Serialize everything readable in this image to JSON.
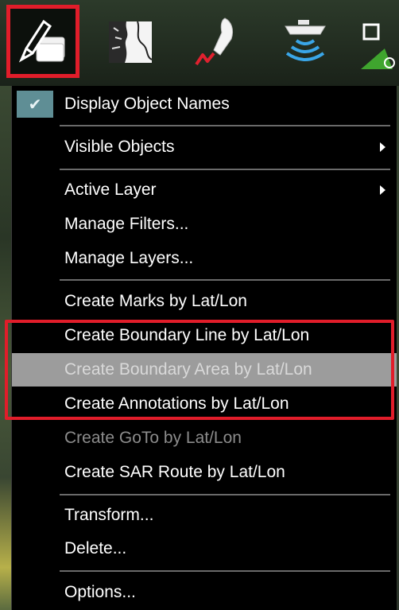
{
  "toolbar": {
    "tools": [
      {
        "icon": "edit-objects-icon",
        "active": true
      },
      {
        "icon": "chart-map-icon",
        "active": false
      },
      {
        "icon": "vessel-track-icon",
        "active": false
      },
      {
        "icon": "sonar-ship-icon",
        "active": false
      },
      {
        "icon": "select-pointer-icon",
        "active": false
      }
    ]
  },
  "menu": {
    "items": [
      {
        "label": "Display Object Names",
        "checked": true
      },
      {
        "label": "Visible Objects",
        "submenu": true
      },
      {
        "label": "Active Layer",
        "submenu": true
      },
      {
        "label": "Manage Filters..."
      },
      {
        "label": "Manage Layers..."
      },
      {
        "label": "Create Marks by Lat/Lon"
      },
      {
        "label": "Create Boundary Line by Lat/Lon"
      },
      {
        "label": "Create Boundary Area by Lat/Lon",
        "highlighted": true
      },
      {
        "label": "Create Annotations by Lat/Lon"
      },
      {
        "label": "Create GoTo by Lat/Lon",
        "disabled": true
      },
      {
        "label": "Create SAR Route by Lat/Lon"
      },
      {
        "label": "Transform..."
      },
      {
        "label": "Delete..."
      },
      {
        "label": "Options..."
      }
    ]
  },
  "colors": {
    "highlight_box": "#e11d2a",
    "menu_bg": "#000000",
    "selected_row": "#9c9c9c",
    "check_bg": "#5f8e95"
  }
}
